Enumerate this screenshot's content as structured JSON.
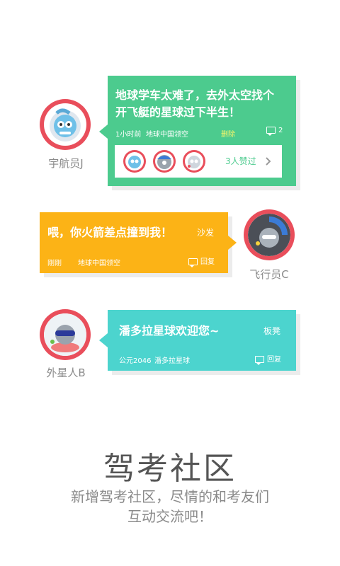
{
  "posts": [
    {
      "user": "宇航员J",
      "title_line1": "地球学车太难了，去外太空找个",
      "title_line2": "开飞艇的星球过下半生！",
      "time": "1小时前",
      "location": "地球中国领空",
      "delete_label": "删除",
      "comment_count": "2",
      "likes_label": "3人赞过",
      "color": "#4ccb8e"
    },
    {
      "user": "飞行员C",
      "title": "喂，你火箭差点撞到我！",
      "tag": "沙发",
      "time": "刚刚",
      "location": "地球中国领空",
      "reply_label": "回复",
      "color": "#fcb316"
    },
    {
      "user": "外星人B",
      "title": "潘多拉星球欢迎您~",
      "tag": "板凳",
      "time": "公元2046",
      "location": "潘多拉星球",
      "reply_label": "回复",
      "color": "#4cd4ce"
    }
  ],
  "footer": {
    "title": "驾考社区",
    "line1": "新增驾考社区，尽情的和考友们",
    "line2": "互动交流吧！"
  }
}
